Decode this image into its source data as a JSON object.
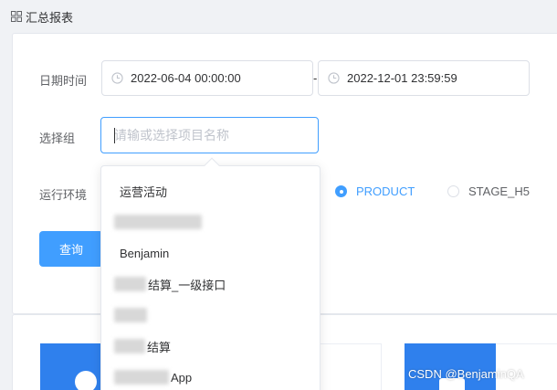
{
  "header": {
    "title": "汇总报表",
    "icon": "grid-icon"
  },
  "form": {
    "date_label": "日期时间",
    "start_date": "2022-06-04 00:00:00",
    "date_separator": "-",
    "end_date": "2022-12-01 23:59:59",
    "group_label": "选择组",
    "group_placeholder": "请输或选择项目名称",
    "env_label": "运行环境",
    "env_options": [
      {
        "label": "PRODUCT",
        "selected": true
      },
      {
        "label": "STAGE_H5",
        "selected": false
      }
    ],
    "query_button": "查询"
  },
  "dropdown": {
    "items": [
      {
        "text": "运营活动",
        "redacted": false
      },
      {
        "text": "",
        "redacted": true
      },
      {
        "text": "Benjamin",
        "redacted": false
      },
      {
        "text": "结算_一级接口",
        "redacted": true
      },
      {
        "text": "",
        "redacted": true
      },
      {
        "text": "结算",
        "redacted": true
      },
      {
        "text": "App",
        "redacted": true
      }
    ]
  },
  "watermark": "CSDN @BenjaminQA",
  "colors": {
    "primary": "#409eff",
    "tile": "#2f80ed"
  }
}
